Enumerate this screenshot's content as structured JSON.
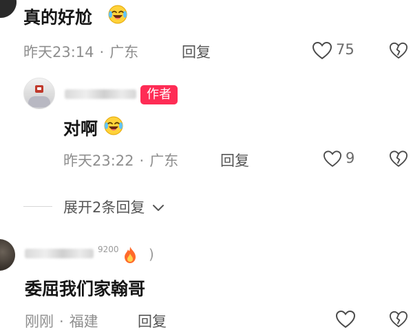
{
  "comments": [
    {
      "text": "真的好尬",
      "time": "昨天23:14",
      "location": "广东",
      "reply_label": "回复",
      "likes": "75"
    },
    {
      "badge": "作者",
      "text": "对啊",
      "time": "昨天23:22",
      "location": "广东",
      "reply_label": "回复",
      "likes": "9"
    },
    {
      "level_badge": "9200",
      "paren_close": ")",
      "text": "委屈我们家翰哥",
      "time": "刚刚",
      "location": "福建",
      "reply_label": "回复"
    }
  ],
  "expand_replies": "展开2条回复",
  "separator": "·",
  "colors": {
    "author_badge": "#fe2c55",
    "meta_text": "#8e8e8e",
    "icon_stroke": "#4a4a4a"
  },
  "icons": [
    "laugh-cry-emoji-icon",
    "heart-icon",
    "broken-heart-icon",
    "chevron-down-icon",
    "fire-icon"
  ]
}
